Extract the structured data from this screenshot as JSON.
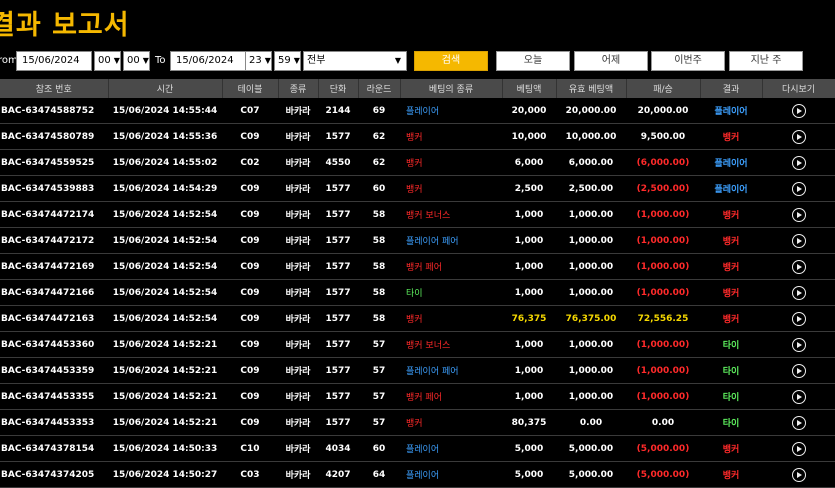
{
  "page": {
    "title": "결과 보고서"
  },
  "filter": {
    "from_label": "rom",
    "from_date": "15/06/2024",
    "from_hour": "00",
    "from_min": "00",
    "to_label": "To",
    "to_date": "15/06/2024",
    "to_hour": "23",
    "to_min": "59",
    "type_value": "전부",
    "search_label": "검색",
    "today_label": "오늘",
    "yesterday_label": "어제",
    "thisweek_label": "이번주",
    "lastweek_label": "지난 주"
  },
  "table": {
    "headers": [
      "참조 번호",
      "시간",
      "테이블",
      "종류",
      "단화",
      "라운드",
      "베팅의 종류",
      "베팅액",
      "유효 베팅액",
      "패/승",
      "결과",
      "다시보기"
    ],
    "rows": [
      {
        "ref": "BAC-63474588752",
        "time": "15/06/2024 14:55:44",
        "table": "C07",
        "type": "바카라",
        "shoe": "2144",
        "round": "69",
        "bet": "플레이어",
        "betc": "c-player",
        "amount": "20,000",
        "valid": "20,000.00",
        "pl": "20,000.00",
        "plc": "",
        "result": "플레이어",
        "resc": "c-player",
        "amtc": ""
      },
      {
        "ref": "BAC-63474580789",
        "time": "15/06/2024 14:55:36",
        "table": "C09",
        "type": "바카라",
        "shoe": "1577",
        "round": "62",
        "bet": "뱅커",
        "betc": "c-banker",
        "amount": "10,000",
        "valid": "10,000.00",
        "pl": "9,500.00",
        "plc": "",
        "result": "뱅커",
        "resc": "c-banker",
        "amtc": ""
      },
      {
        "ref": "BAC-63474559525",
        "time": "15/06/2024 14:55:02",
        "table": "C02",
        "type": "바카라",
        "shoe": "4550",
        "round": "62",
        "bet": "뱅커",
        "betc": "c-banker",
        "amount": "6,000",
        "valid": "6,000.00",
        "pl": "(6,000.00)",
        "plc": "c-neg",
        "result": "플레이어",
        "resc": "c-player",
        "amtc": ""
      },
      {
        "ref": "BAC-63474539883",
        "time": "15/06/2024 14:54:29",
        "table": "C09",
        "type": "바카라",
        "shoe": "1577",
        "round": "60",
        "bet": "뱅커",
        "betc": "c-banker",
        "amount": "2,500",
        "valid": "2,500.00",
        "pl": "(2,500.00)",
        "plc": "c-neg",
        "result": "플레이어",
        "resc": "c-player",
        "amtc": ""
      },
      {
        "ref": "BAC-63474472174",
        "time": "15/06/2024 14:52:54",
        "table": "C09",
        "type": "바카라",
        "shoe": "1577",
        "round": "58",
        "bet": "뱅커 보너스",
        "betc": "c-banker",
        "amount": "1,000",
        "valid": "1,000.00",
        "pl": "(1,000.00)",
        "plc": "c-neg",
        "result": "뱅커",
        "resc": "c-banker",
        "amtc": ""
      },
      {
        "ref": "BAC-63474472172",
        "time": "15/06/2024 14:52:54",
        "table": "C09",
        "type": "바카라",
        "shoe": "1577",
        "round": "58",
        "bet": "플레이어 페어",
        "betc": "c-player",
        "amount": "1,000",
        "valid": "1,000.00",
        "pl": "(1,000.00)",
        "plc": "c-neg",
        "result": "뱅커",
        "resc": "c-banker",
        "amtc": ""
      },
      {
        "ref": "BAC-63474472169",
        "time": "15/06/2024 14:52:54",
        "table": "C09",
        "type": "바카라",
        "shoe": "1577",
        "round": "58",
        "bet": "뱅커 페어",
        "betc": "c-banker",
        "amount": "1,000",
        "valid": "1,000.00",
        "pl": "(1,000.00)",
        "plc": "c-neg",
        "result": "뱅커",
        "resc": "c-banker",
        "amtc": ""
      },
      {
        "ref": "BAC-63474472166",
        "time": "15/06/2024 14:52:54",
        "table": "C09",
        "type": "바카라",
        "shoe": "1577",
        "round": "58",
        "bet": "타이",
        "betc": "c-tie",
        "amount": "1,000",
        "valid": "1,000.00",
        "pl": "(1,000.00)",
        "plc": "c-neg",
        "result": "뱅커",
        "resc": "c-banker",
        "amtc": ""
      },
      {
        "ref": "BAC-63474472163",
        "time": "15/06/2024 14:52:54",
        "table": "C09",
        "type": "바카라",
        "shoe": "1577",
        "round": "58",
        "bet": "뱅커",
        "betc": "c-banker",
        "amount": "76,375",
        "valid": "76,375.00",
        "pl": "72,556.25",
        "plc": "c-yel",
        "result": "뱅커",
        "resc": "c-banker",
        "amtc": "c-yel"
      },
      {
        "ref": "BAC-63474453360",
        "time": "15/06/2024 14:52:21",
        "table": "C09",
        "type": "바카라",
        "shoe": "1577",
        "round": "57",
        "bet": "뱅커 보너스",
        "betc": "c-banker",
        "amount": "1,000",
        "valid": "1,000.00",
        "pl": "(1,000.00)",
        "plc": "c-neg",
        "result": "타이",
        "resc": "c-tie",
        "amtc": ""
      },
      {
        "ref": "BAC-63474453359",
        "time": "15/06/2024 14:52:21",
        "table": "C09",
        "type": "바카라",
        "shoe": "1577",
        "round": "57",
        "bet": "플레이어 페어",
        "betc": "c-player",
        "amount": "1,000",
        "valid": "1,000.00",
        "pl": "(1,000.00)",
        "plc": "c-neg",
        "result": "타이",
        "resc": "c-tie",
        "amtc": ""
      },
      {
        "ref": "BAC-63474453355",
        "time": "15/06/2024 14:52:21",
        "table": "C09",
        "type": "바카라",
        "shoe": "1577",
        "round": "57",
        "bet": "뱅커 페어",
        "betc": "c-banker",
        "amount": "1,000",
        "valid": "1,000.00",
        "pl": "(1,000.00)",
        "plc": "c-neg",
        "result": "타이",
        "resc": "c-tie",
        "amtc": ""
      },
      {
        "ref": "BAC-63474453353",
        "time": "15/06/2024 14:52:21",
        "table": "C09",
        "type": "바카라",
        "shoe": "1577",
        "round": "57",
        "bet": "뱅커",
        "betc": "c-banker",
        "amount": "80,375",
        "valid": "0.00",
        "pl": "0.00",
        "plc": "",
        "result": "타이",
        "resc": "c-tie",
        "amtc": ""
      },
      {
        "ref": "BAC-63474378154",
        "time": "15/06/2024 14:50:33",
        "table": "C10",
        "type": "바카라",
        "shoe": "4034",
        "round": "60",
        "bet": "플레이어",
        "betc": "c-player",
        "amount": "5,000",
        "valid": "5,000.00",
        "pl": "(5,000.00)",
        "plc": "c-neg",
        "result": "뱅커",
        "resc": "c-banker",
        "amtc": ""
      },
      {
        "ref": "BAC-63474374205",
        "time": "15/06/2024 14:50:27",
        "table": "C03",
        "type": "바카라",
        "shoe": "4207",
        "round": "64",
        "bet": "플레이어",
        "betc": "c-player",
        "amount": "5,000",
        "valid": "5,000.00",
        "pl": "(5,000.00)",
        "plc": "c-neg",
        "result": "뱅커",
        "resc": "c-banker",
        "amtc": ""
      }
    ]
  }
}
